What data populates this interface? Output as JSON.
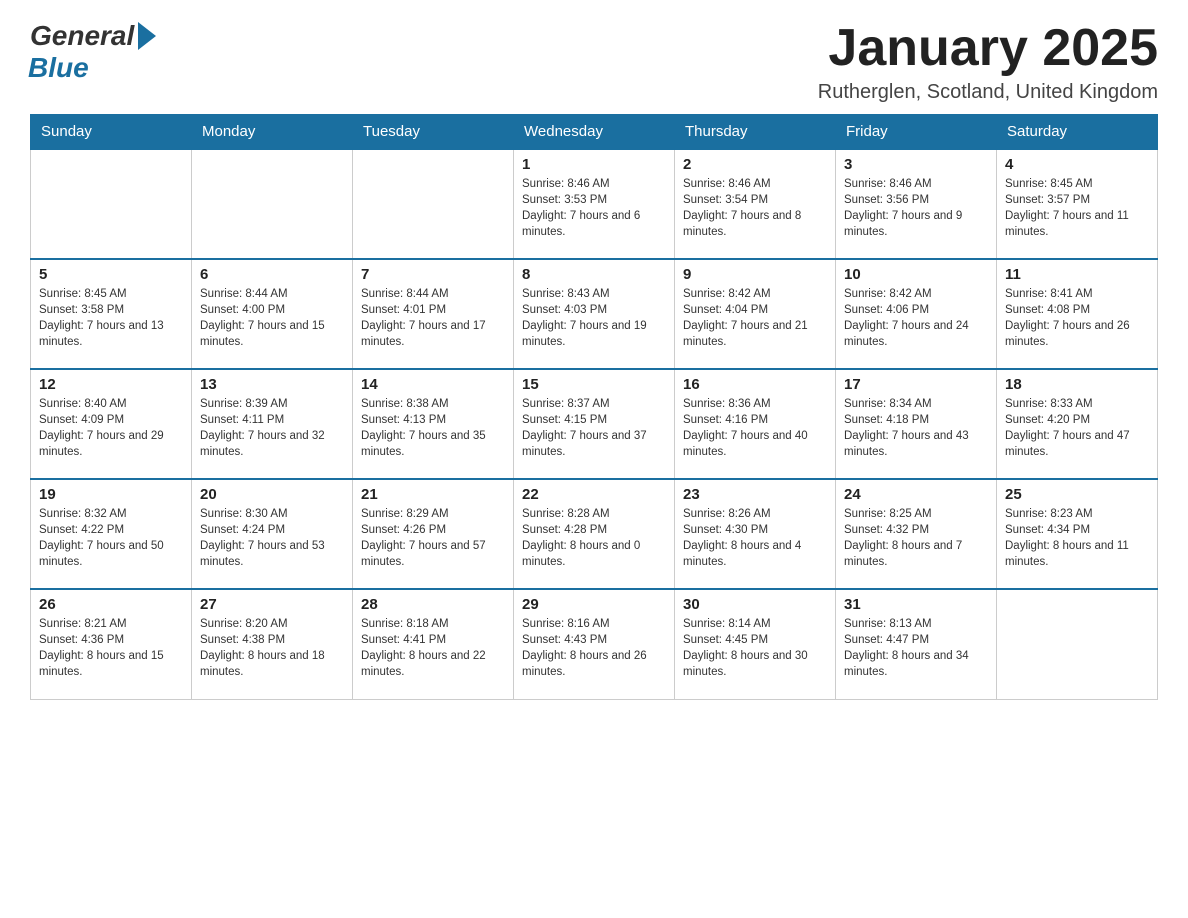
{
  "header": {
    "logo_general": "General",
    "logo_blue": "Blue",
    "month_title": "January 2025",
    "location": "Rutherglen, Scotland, United Kingdom"
  },
  "weekdays": [
    "Sunday",
    "Monday",
    "Tuesday",
    "Wednesday",
    "Thursday",
    "Friday",
    "Saturday"
  ],
  "weeks": [
    [
      {
        "day": "",
        "sunrise": "",
        "sunset": "",
        "daylight": ""
      },
      {
        "day": "",
        "sunrise": "",
        "sunset": "",
        "daylight": ""
      },
      {
        "day": "",
        "sunrise": "",
        "sunset": "",
        "daylight": ""
      },
      {
        "day": "1",
        "sunrise": "Sunrise: 8:46 AM",
        "sunset": "Sunset: 3:53 PM",
        "daylight": "Daylight: 7 hours and 6 minutes."
      },
      {
        "day": "2",
        "sunrise": "Sunrise: 8:46 AM",
        "sunset": "Sunset: 3:54 PM",
        "daylight": "Daylight: 7 hours and 8 minutes."
      },
      {
        "day": "3",
        "sunrise": "Sunrise: 8:46 AM",
        "sunset": "Sunset: 3:56 PM",
        "daylight": "Daylight: 7 hours and 9 minutes."
      },
      {
        "day": "4",
        "sunrise": "Sunrise: 8:45 AM",
        "sunset": "Sunset: 3:57 PM",
        "daylight": "Daylight: 7 hours and 11 minutes."
      }
    ],
    [
      {
        "day": "5",
        "sunrise": "Sunrise: 8:45 AM",
        "sunset": "Sunset: 3:58 PM",
        "daylight": "Daylight: 7 hours and 13 minutes."
      },
      {
        "day": "6",
        "sunrise": "Sunrise: 8:44 AM",
        "sunset": "Sunset: 4:00 PM",
        "daylight": "Daylight: 7 hours and 15 minutes."
      },
      {
        "day": "7",
        "sunrise": "Sunrise: 8:44 AM",
        "sunset": "Sunset: 4:01 PM",
        "daylight": "Daylight: 7 hours and 17 minutes."
      },
      {
        "day": "8",
        "sunrise": "Sunrise: 8:43 AM",
        "sunset": "Sunset: 4:03 PM",
        "daylight": "Daylight: 7 hours and 19 minutes."
      },
      {
        "day": "9",
        "sunrise": "Sunrise: 8:42 AM",
        "sunset": "Sunset: 4:04 PM",
        "daylight": "Daylight: 7 hours and 21 minutes."
      },
      {
        "day": "10",
        "sunrise": "Sunrise: 8:42 AM",
        "sunset": "Sunset: 4:06 PM",
        "daylight": "Daylight: 7 hours and 24 minutes."
      },
      {
        "day": "11",
        "sunrise": "Sunrise: 8:41 AM",
        "sunset": "Sunset: 4:08 PM",
        "daylight": "Daylight: 7 hours and 26 minutes."
      }
    ],
    [
      {
        "day": "12",
        "sunrise": "Sunrise: 8:40 AM",
        "sunset": "Sunset: 4:09 PM",
        "daylight": "Daylight: 7 hours and 29 minutes."
      },
      {
        "day": "13",
        "sunrise": "Sunrise: 8:39 AM",
        "sunset": "Sunset: 4:11 PM",
        "daylight": "Daylight: 7 hours and 32 minutes."
      },
      {
        "day": "14",
        "sunrise": "Sunrise: 8:38 AM",
        "sunset": "Sunset: 4:13 PM",
        "daylight": "Daylight: 7 hours and 35 minutes."
      },
      {
        "day": "15",
        "sunrise": "Sunrise: 8:37 AM",
        "sunset": "Sunset: 4:15 PM",
        "daylight": "Daylight: 7 hours and 37 minutes."
      },
      {
        "day": "16",
        "sunrise": "Sunrise: 8:36 AM",
        "sunset": "Sunset: 4:16 PM",
        "daylight": "Daylight: 7 hours and 40 minutes."
      },
      {
        "day": "17",
        "sunrise": "Sunrise: 8:34 AM",
        "sunset": "Sunset: 4:18 PM",
        "daylight": "Daylight: 7 hours and 43 minutes."
      },
      {
        "day": "18",
        "sunrise": "Sunrise: 8:33 AM",
        "sunset": "Sunset: 4:20 PM",
        "daylight": "Daylight: 7 hours and 47 minutes."
      }
    ],
    [
      {
        "day": "19",
        "sunrise": "Sunrise: 8:32 AM",
        "sunset": "Sunset: 4:22 PM",
        "daylight": "Daylight: 7 hours and 50 minutes."
      },
      {
        "day": "20",
        "sunrise": "Sunrise: 8:30 AM",
        "sunset": "Sunset: 4:24 PM",
        "daylight": "Daylight: 7 hours and 53 minutes."
      },
      {
        "day": "21",
        "sunrise": "Sunrise: 8:29 AM",
        "sunset": "Sunset: 4:26 PM",
        "daylight": "Daylight: 7 hours and 57 minutes."
      },
      {
        "day": "22",
        "sunrise": "Sunrise: 8:28 AM",
        "sunset": "Sunset: 4:28 PM",
        "daylight": "Daylight: 8 hours and 0 minutes."
      },
      {
        "day": "23",
        "sunrise": "Sunrise: 8:26 AM",
        "sunset": "Sunset: 4:30 PM",
        "daylight": "Daylight: 8 hours and 4 minutes."
      },
      {
        "day": "24",
        "sunrise": "Sunrise: 8:25 AM",
        "sunset": "Sunset: 4:32 PM",
        "daylight": "Daylight: 8 hours and 7 minutes."
      },
      {
        "day": "25",
        "sunrise": "Sunrise: 8:23 AM",
        "sunset": "Sunset: 4:34 PM",
        "daylight": "Daylight: 8 hours and 11 minutes."
      }
    ],
    [
      {
        "day": "26",
        "sunrise": "Sunrise: 8:21 AM",
        "sunset": "Sunset: 4:36 PM",
        "daylight": "Daylight: 8 hours and 15 minutes."
      },
      {
        "day": "27",
        "sunrise": "Sunrise: 8:20 AM",
        "sunset": "Sunset: 4:38 PM",
        "daylight": "Daylight: 8 hours and 18 minutes."
      },
      {
        "day": "28",
        "sunrise": "Sunrise: 8:18 AM",
        "sunset": "Sunset: 4:41 PM",
        "daylight": "Daylight: 8 hours and 22 minutes."
      },
      {
        "day": "29",
        "sunrise": "Sunrise: 8:16 AM",
        "sunset": "Sunset: 4:43 PM",
        "daylight": "Daylight: 8 hours and 26 minutes."
      },
      {
        "day": "30",
        "sunrise": "Sunrise: 8:14 AM",
        "sunset": "Sunset: 4:45 PM",
        "daylight": "Daylight: 8 hours and 30 minutes."
      },
      {
        "day": "31",
        "sunrise": "Sunrise: 8:13 AM",
        "sunset": "Sunset: 4:47 PM",
        "daylight": "Daylight: 8 hours and 34 minutes."
      },
      {
        "day": "",
        "sunrise": "",
        "sunset": "",
        "daylight": ""
      }
    ]
  ]
}
